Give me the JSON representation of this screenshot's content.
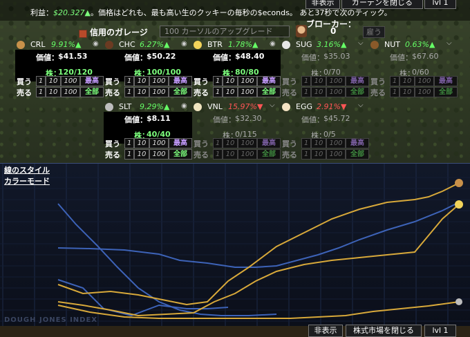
{
  "topbar": {
    "profit_label": "利益：",
    "profit_value": "$20.327▲",
    "info": "。価格はどれも、最も高い生のクッキーの毎秒の$econds。 あと37秒で次のティック。",
    "hide_label": "非表示",
    "close_label": "ガーデンを閉じる",
    "level_label": "lvl 1"
  },
  "garage": {
    "title": "信用のガレージ",
    "description": "100 カーソルのアップグレード"
  },
  "broker": {
    "label": "ブローカー：",
    "count": "0",
    "hire_label": "雇う"
  },
  "row_labels": {
    "buy": "買う",
    "sell": "売る",
    "price": "価値：",
    "shares": "株："
  },
  "buttons": {
    "one": "1",
    "ten": "10",
    "hundred": "100",
    "max": "最高",
    "all": "全部"
  },
  "stocks": [
    {
      "symbol": "CRL",
      "pct": "9.91%▲",
      "dir": "up",
      "price": "$41.53",
      "shares": "120/120",
      "active": true,
      "icon_color": "#c8914a",
      "toggle": "eye"
    },
    {
      "symbol": "CHC",
      "pct": "6.27%▲",
      "dir": "up",
      "price": "$50.22",
      "shares": "100/100",
      "active": true,
      "icon_color": "#6b3b22",
      "toggle": "eye"
    },
    {
      "symbol": "BTR",
      "pct": "1.78%▲",
      "dir": "up",
      "price": "$48.40",
      "shares": "80/80",
      "active": true,
      "icon_color": "#f2d35a",
      "toggle": "eye"
    },
    {
      "symbol": "SUG",
      "pct": "3.16%▲",
      "dir": "up",
      "price": "$35.03",
      "shares": "0/70",
      "active": false,
      "icon_color": "#e7e7e7",
      "toggle": "chev"
    },
    {
      "symbol": "NUT",
      "pct": "0.63%▲",
      "dir": "up",
      "price": "$67.60",
      "shares": "0/60",
      "active": false,
      "icon_color": "#8a5a2a",
      "toggle": "chev"
    },
    {
      "symbol": "SLT",
      "pct": "9.29%▲",
      "dir": "up",
      "price": "$8.11",
      "shares": "40/40",
      "active": true,
      "icon_color": "#bdbdbd",
      "toggle": "eye"
    },
    {
      "symbol": "VNL",
      "pct": "15.97%▼",
      "dir": "down",
      "price": "$32.30",
      "shares": "0/115",
      "active": false,
      "icon_color": "#f0e4c0",
      "toggle": "chev"
    },
    {
      "symbol": "EGG",
      "pct": "2.91%▼",
      "dir": "down",
      "price": "$45.72",
      "shares": "0/5",
      "active": false,
      "icon_color": "#f4e3c3",
      "toggle": "chev"
    }
  ],
  "graph": {
    "line_style": "線のスタイル",
    "color_mode": "カラーモード",
    "watermark": "DOUGH JONES INDEX",
    "hide_label": "非表示",
    "close_label": "株式市場を閉じる",
    "level_label": "lvl 1",
    "colors": {
      "gold": "#d8a93a",
      "blue": "#3d63b8"
    }
  },
  "colors": {
    "profit": "#7dff7d",
    "gain": "#66ff66",
    "loss": "#ff5555",
    "max": "#c69cff"
  }
}
